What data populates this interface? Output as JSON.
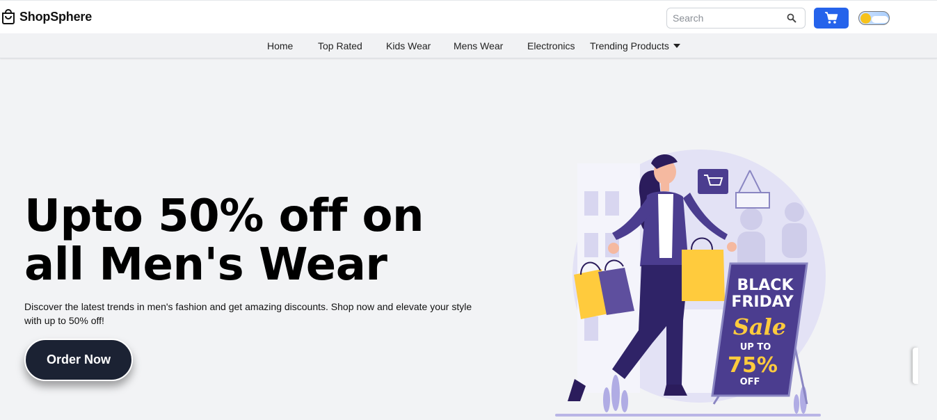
{
  "brand": {
    "name": "ShopSphere",
    "icon": "shopping-bag-icon"
  },
  "search": {
    "placeholder": "Search",
    "value": "",
    "icon": "search-icon"
  },
  "cart": {
    "icon": "cart-icon",
    "color": "#2563eb"
  },
  "theme_toggle": {
    "icon": "sun-icon",
    "state": "light"
  },
  "nav": {
    "items": [
      {
        "label": "Home"
      },
      {
        "label": "Top Rated"
      },
      {
        "label": "Kids Wear"
      },
      {
        "label": "Mens Wear"
      },
      {
        "label": "Electronics"
      },
      {
        "label": "Trending Products",
        "icon": "chevron-down-icon"
      }
    ]
  },
  "hero": {
    "title_line1": "Upto 50% off on",
    "title_line2": "all Men's Wear",
    "description": "Discover the latest trends in men's fashion and get amazing discounts. Shop now and elevate your style with up to 50% off!",
    "cta_label": "Order Now",
    "cta_color": "#1b2233",
    "sign": {
      "line1": "BLACK",
      "line2": "FRIDAY",
      "line3": "Sale",
      "line4": "UP TO",
      "line5": "75%",
      "line6": "OFF"
    }
  }
}
